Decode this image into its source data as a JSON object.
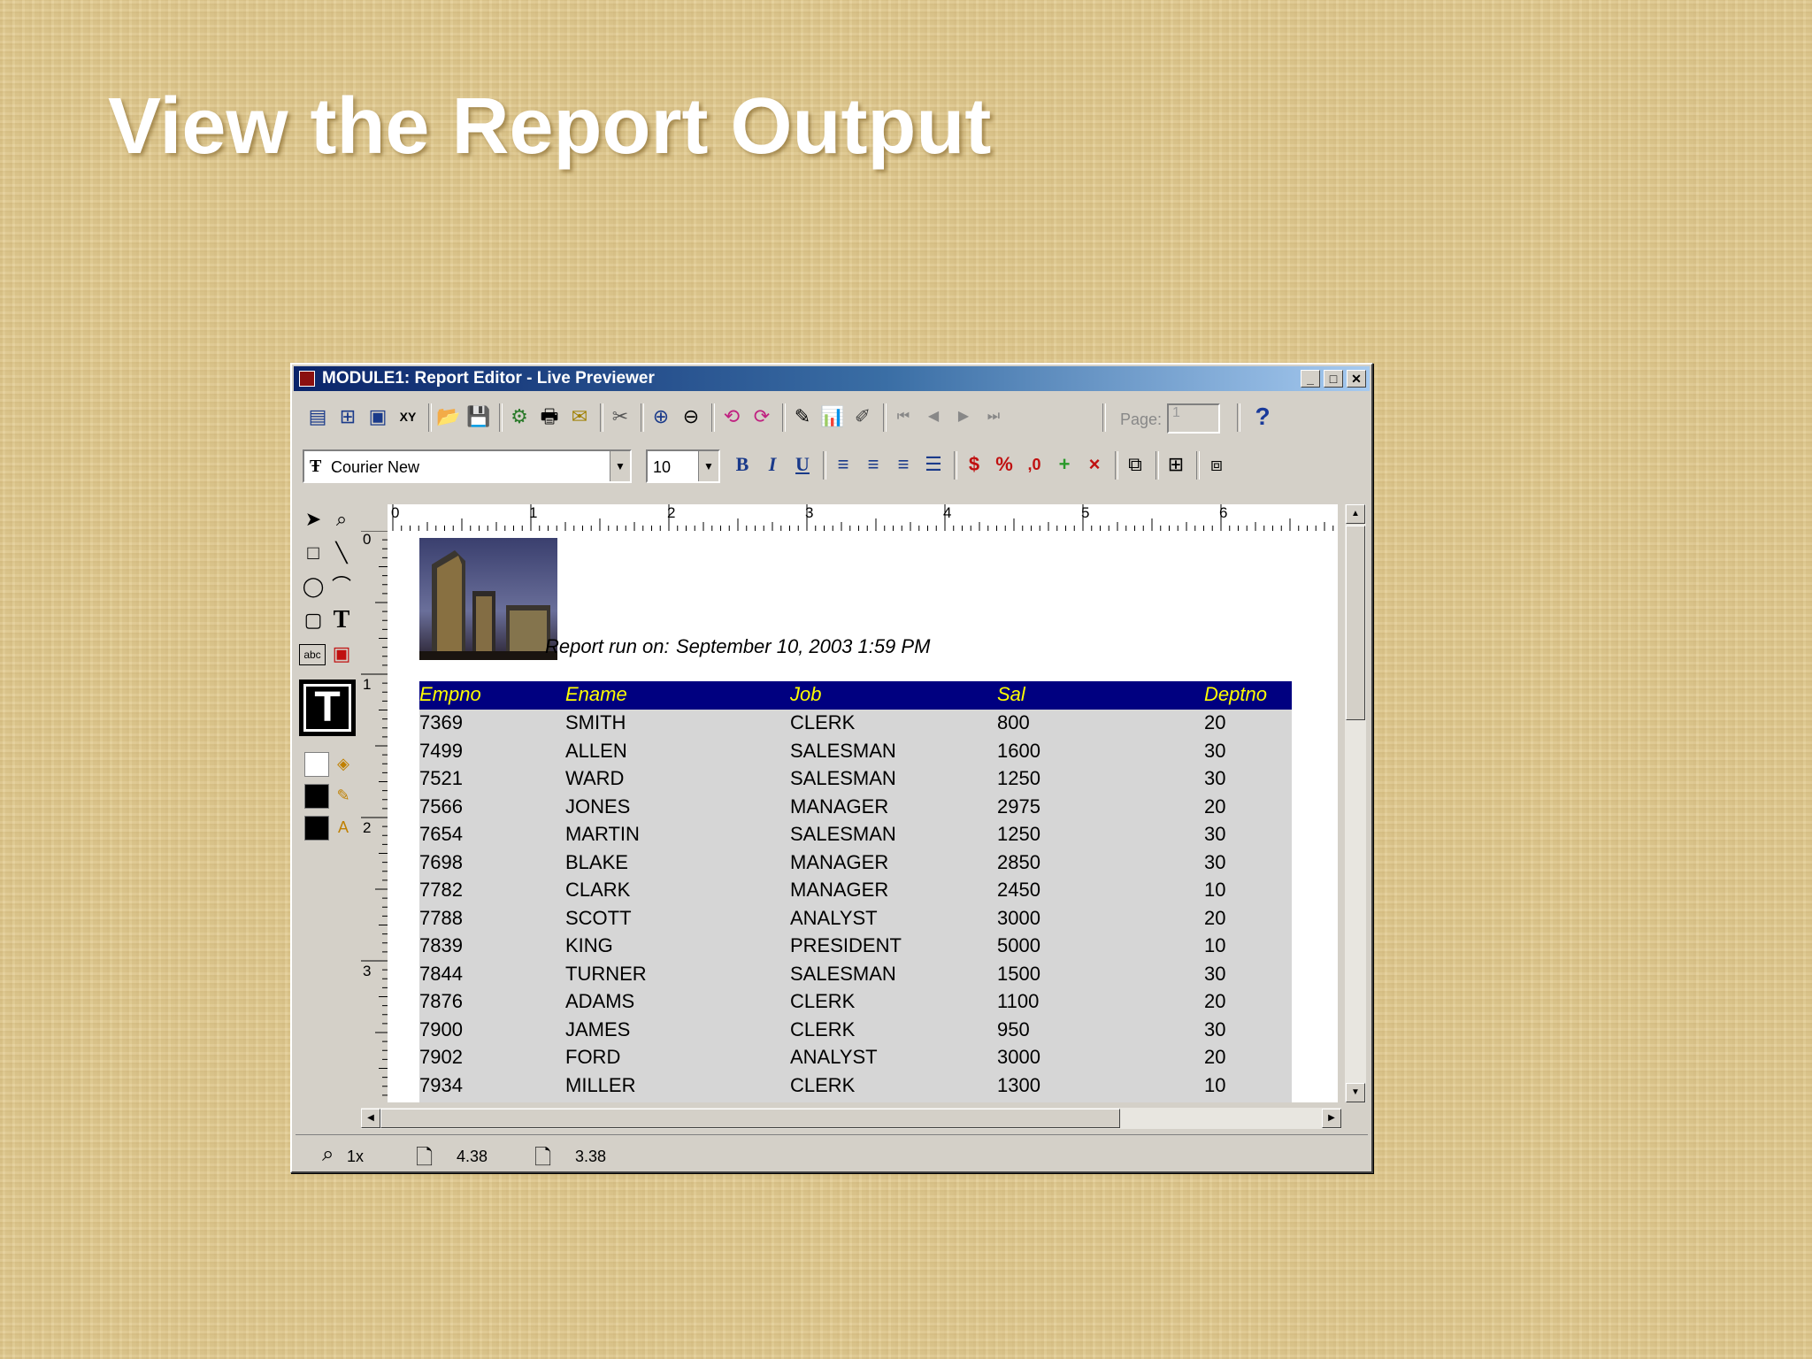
{
  "slide": {
    "title": "View the Report Output"
  },
  "window": {
    "title": "MODULE1: Report Editor - Live Previewer",
    "controls": {
      "minimize": "_",
      "maximize": "□",
      "close": "✕"
    }
  },
  "toolbar": {
    "page_label": "Page:",
    "page_value": "1",
    "help_label": "?"
  },
  "format_bar": {
    "font_name": "Courier New",
    "font_size": "10",
    "bold_label": "B",
    "italic_label": "I",
    "underline_label": "U",
    "currency_label": "$",
    "percent_label": "%",
    "comma_label": ",0"
  },
  "palette": {
    "text_tool_label": "T",
    "abc_label": "abc"
  },
  "ruler": {
    "horizontal": [
      "0",
      "1",
      "2",
      "3",
      "4",
      "5",
      "6"
    ],
    "vertical": [
      "0",
      "1",
      "2",
      "3"
    ]
  },
  "report": {
    "run_on_label": "Report run on:",
    "run_on_value": "September 10, 2003 1:59 PM",
    "columns": [
      "Empno",
      "Ename",
      "Job",
      "Sal",
      "Deptno"
    ],
    "rows": [
      [
        "7369",
        "SMITH",
        "CLERK",
        "800",
        "20"
      ],
      [
        "7499",
        "ALLEN",
        "SALESMAN",
        "1600",
        "30"
      ],
      [
        "7521",
        "WARD",
        "SALESMAN",
        "1250",
        "30"
      ],
      [
        "7566",
        "JONES",
        "MANAGER",
        "2975",
        "20"
      ],
      [
        "7654",
        "MARTIN",
        "SALESMAN",
        "1250",
        "30"
      ],
      [
        "7698",
        "BLAKE",
        "MANAGER",
        "2850",
        "30"
      ],
      [
        "7782",
        "CLARK",
        "MANAGER",
        "2450",
        "10"
      ],
      [
        "7788",
        "SCOTT",
        "ANALYST",
        "3000",
        "20"
      ],
      [
        "7839",
        "KING",
        "PRESIDENT",
        "5000",
        "10"
      ],
      [
        "7844",
        "TURNER",
        "SALESMAN",
        "1500",
        "30"
      ],
      [
        "7876",
        "ADAMS",
        "CLERK",
        "1100",
        "20"
      ],
      [
        "7900",
        "JAMES",
        "CLERK",
        "950",
        "30"
      ],
      [
        "7902",
        "FORD",
        "ANALYST",
        "3000",
        "20"
      ],
      [
        "7934",
        "MILLER",
        "CLERK",
        "1300",
        "10"
      ]
    ],
    "colors": {
      "header_bg": "#000080",
      "header_text": "#ffff00",
      "body_bg": "#d6d6d6"
    }
  },
  "statusbar": {
    "zoom": "1x",
    "x_pos": "4.38",
    "y_pos": "3.38"
  }
}
